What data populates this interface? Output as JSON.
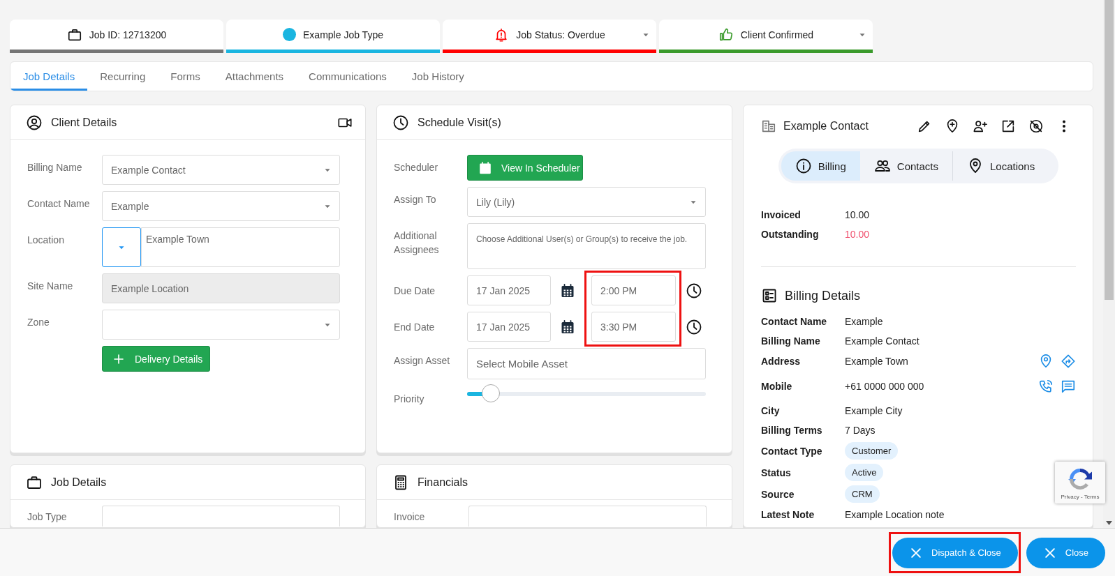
{
  "status_cards": [
    {
      "kind": "job_id",
      "text": "Job ID: 12713200",
      "color": "#757575",
      "dropdown": false
    },
    {
      "kind": "job_type",
      "text": "Example Job Type",
      "color": "#1ab5e0",
      "dropdown": false
    },
    {
      "kind": "status",
      "text": "Job Status: Overdue",
      "color": "#ff0000",
      "dropdown": true
    },
    {
      "kind": "confirmation",
      "text": "Client Confirmed",
      "color": "#3a9a2b",
      "dropdown": true
    }
  ],
  "tabs": [
    {
      "label": "Job Details",
      "selected": true
    },
    {
      "label": "Recurring",
      "selected": false
    },
    {
      "label": "Forms",
      "selected": false
    },
    {
      "label": "Attachments",
      "selected": false
    },
    {
      "label": "Communications",
      "selected": false
    },
    {
      "label": "Job History",
      "selected": false
    }
  ],
  "client_details": {
    "title": "Client Details",
    "fields": [
      {
        "label": "Billing Name",
        "kind": "select",
        "value": "Example Contact"
      },
      {
        "label": "Contact Name",
        "kind": "select",
        "value": "Example"
      },
      {
        "label": "Location",
        "kind": "location",
        "value": "Example Town"
      },
      {
        "label": "Site Name",
        "kind": "readonly",
        "value": "Example Location"
      },
      {
        "label": "Zone",
        "kind": "select"
      }
    ],
    "button": "Delivery Details"
  },
  "schedule": {
    "title": "Schedule Visit(s)",
    "scheduler_label": "Scheduler",
    "scheduler_button": "View In Scheduler",
    "assign_to": {
      "label": "Assign To",
      "value": "Lily (Lily)"
    },
    "assignees": {
      "label": "Additional Assignees",
      "placeholder": "Choose Additional User(s) or Group(s) to receive the job."
    },
    "dates": [
      {
        "label": "Due Date",
        "date": "17 Jan 2025",
        "time": "2:00 PM"
      },
      {
        "label": "End Date",
        "date": "17 Jan 2025",
        "time": "3:30 PM"
      }
    ],
    "times_highlighted": true,
    "asset": {
      "label": "Assign Asset",
      "placeholder": "Select Mobile Asset"
    },
    "priority": {
      "label": "Priority",
      "level": 0.1
    }
  },
  "job_details": {
    "title": "Job Details",
    "field_label": "Job Type"
  },
  "financials": {
    "title": "Financials",
    "field_label": "Invoice"
  },
  "contact": {
    "name": "Example Contact",
    "segments": [
      {
        "kind": "info",
        "label": "Billing",
        "selected": true
      },
      {
        "kind": "people",
        "label": "Contacts",
        "selected": false
      },
      {
        "kind": "pin",
        "label": "Locations",
        "selected": false
      }
    ],
    "totals": [
      {
        "label": "Invoiced",
        "value": "10.00",
        "overdue": false
      },
      {
        "label": "Outstanding",
        "value": "10.00",
        "overdue": true
      }
    ],
    "details_title": "Billing Details",
    "details": [
      {
        "kind": "text",
        "label": "Contact Name",
        "value": "Example"
      },
      {
        "kind": "text",
        "label": "Billing Name",
        "value": "Example Contact"
      },
      {
        "kind": "address",
        "label": "Address",
        "value": "Example Town"
      },
      {
        "kind": "phone",
        "label": "Mobile",
        "value": "+61 0000 000 000"
      },
      {
        "kind": "text",
        "label": "City",
        "value": "Example City"
      },
      {
        "kind": "text",
        "label": "Billing Terms",
        "value": "7 Days"
      },
      {
        "kind": "chip",
        "label": "Contact Type",
        "value": "Customer"
      },
      {
        "kind": "chip",
        "label": "Status",
        "value": "Active"
      },
      {
        "kind": "chip",
        "label": "Source",
        "value": "CRM"
      },
      {
        "kind": "text",
        "label": "Latest Note",
        "value": "Example Location note"
      }
    ]
  },
  "captcha": {
    "text": "Privacy - Terms"
  },
  "footer_buttons": [
    {
      "label": "Dispatch & Close",
      "highlighted": true
    },
    {
      "label": "Close",
      "highlighted": false
    }
  ]
}
